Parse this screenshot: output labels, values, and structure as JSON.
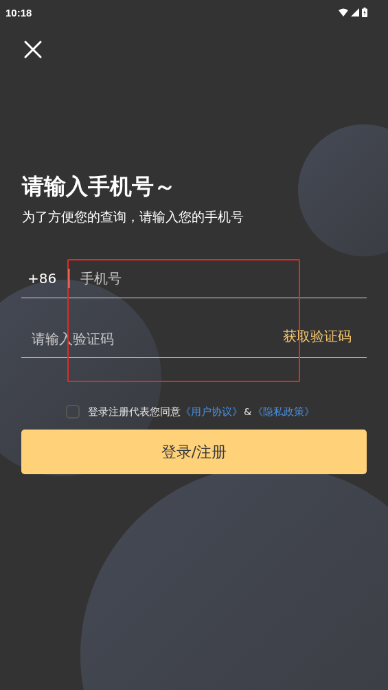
{
  "status_bar": {
    "time": "10:18"
  },
  "heading": {
    "title": "请输入手机号～",
    "subtitle": "为了方便您的查询，请输入您的手机号"
  },
  "phone_field": {
    "country_code": "+86",
    "placeholder": "手机号"
  },
  "code_field": {
    "placeholder": "请输入验证码",
    "action": "获取验证码"
  },
  "agreement": {
    "checked": false,
    "text": "登录注册代表您同意",
    "links": [
      "《用户协议》",
      "《隐私政策》"
    ],
    "joiner": "&"
  },
  "submit_button": {
    "label": "登录/注册"
  }
}
